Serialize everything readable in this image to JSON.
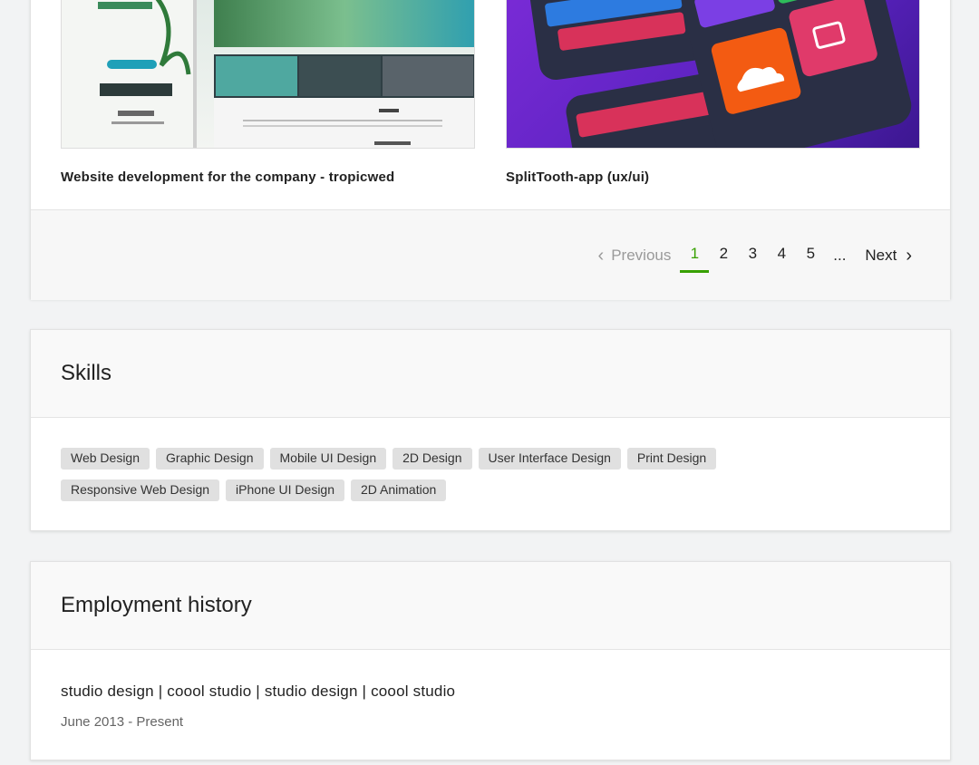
{
  "portfolio": {
    "items": [
      {
        "title": "Website development for the company - tropicwed"
      },
      {
        "title": "SplitTooth-app (ux/ui)"
      }
    ],
    "pagination": {
      "previous_label": "Previous",
      "pages": [
        "1",
        "2",
        "3",
        "4",
        "5"
      ],
      "active_page": "1",
      "ellipsis": "...",
      "next_label": "Next"
    }
  },
  "skills": {
    "heading": "Skills",
    "tags": [
      "Web Design",
      "Graphic Design",
      "Mobile UI Design",
      "2D Design",
      "User Interface Design",
      "Print Design",
      "Responsive Web Design",
      "iPhone UI Design",
      "2D Animation"
    ]
  },
  "employment": {
    "heading": "Employment history",
    "jobs": [
      {
        "title": "studio design | coool studio | studio design | coool studio",
        "dates": "June 2013 - Present"
      }
    ]
  },
  "colors": {
    "accent": "#37a000",
    "tag_bg": "#e0e0e0"
  }
}
